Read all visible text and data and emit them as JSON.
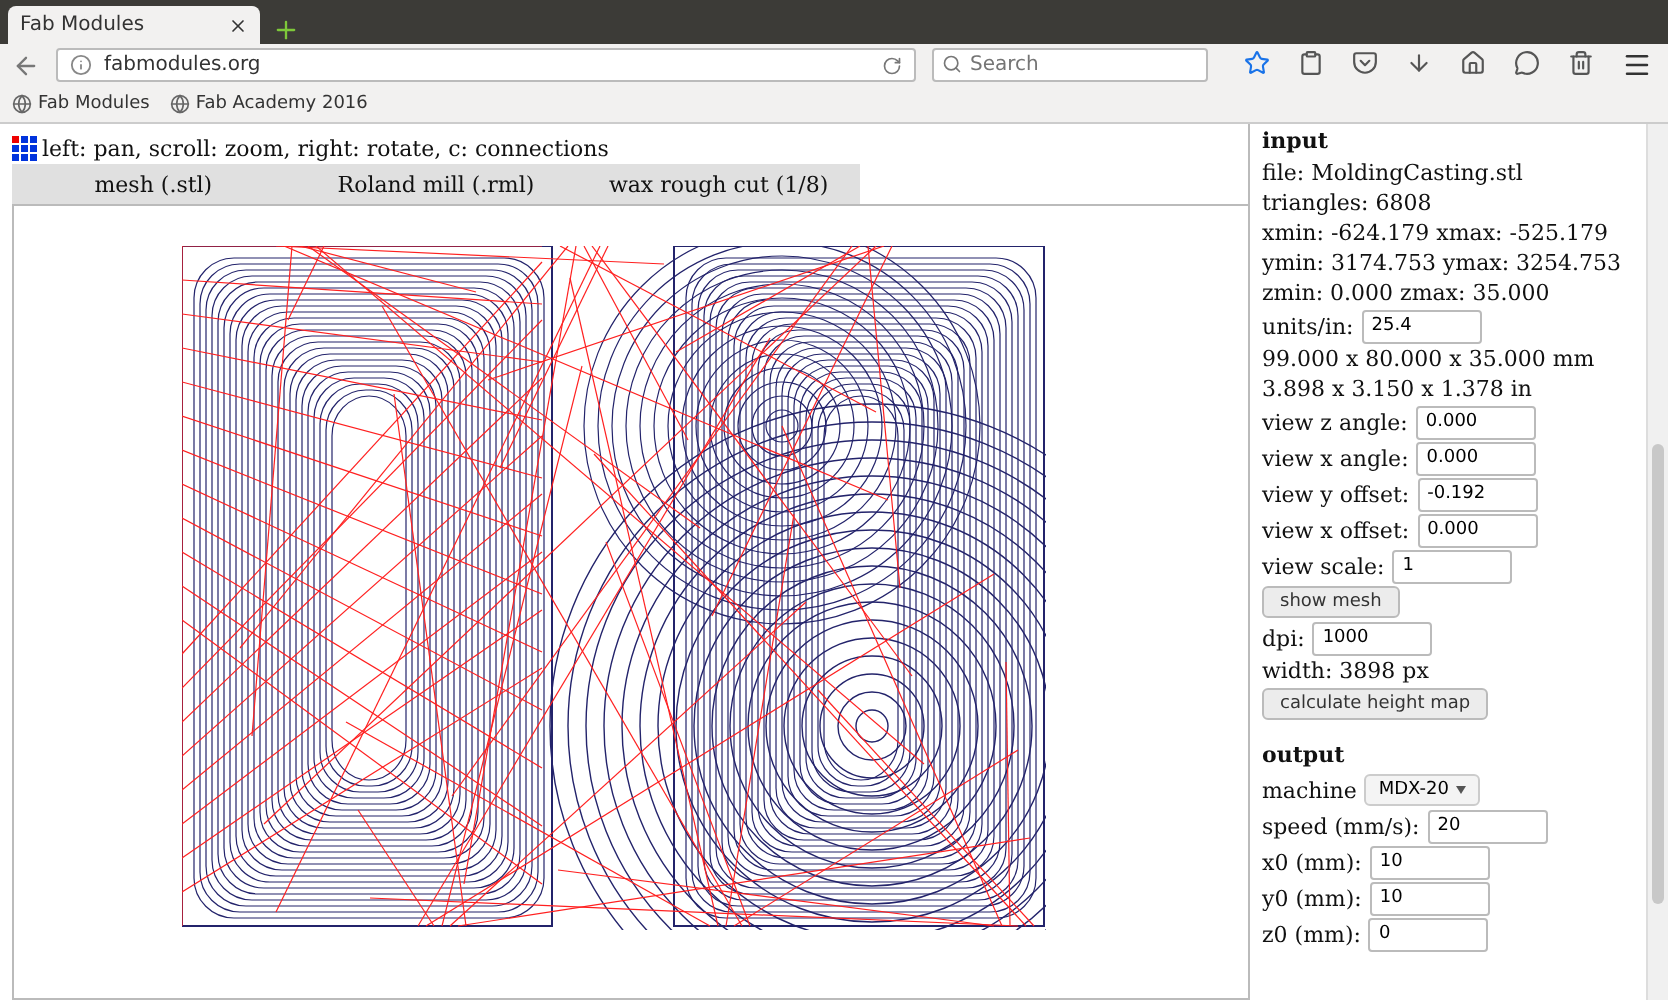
{
  "browser": {
    "tab_title": "Fab Modules",
    "url": "fabmodules.org",
    "search_placeholder": "Search",
    "bookmarks": [
      "Fab Modules",
      "Fab Academy 2016"
    ]
  },
  "page": {
    "hint": "left: pan, scroll: zoom, right: rotate, c: connections",
    "modules": [
      {
        "label": "mesh (.stl)"
      },
      {
        "label": "Roland mill (.rml)"
      },
      {
        "label": "wax rough cut (1/8)"
      }
    ],
    "panel": [
      {
        "kind": "heading",
        "text": "input"
      },
      {
        "kind": "text",
        "text": "file: MoldingCasting.stl"
      },
      {
        "kind": "text",
        "text": "triangles: 6808"
      },
      {
        "kind": "text",
        "text": "xmin: -624.179 xmax: -525.179"
      },
      {
        "kind": "text",
        "text": "ymin: 3174.753 ymax: 3254.753"
      },
      {
        "kind": "text",
        "text": "zmin: 0.000 zmax: 35.000"
      },
      {
        "kind": "field",
        "label": "units/in:",
        "value": "25.4"
      },
      {
        "kind": "text",
        "text": "99.000 x 80.000 x 35.000 mm"
      },
      {
        "kind": "text",
        "text": "3.898 x 3.150 x 1.378 in"
      },
      {
        "kind": "field",
        "label": "view z angle:",
        "value": "0.000"
      },
      {
        "kind": "field",
        "label": "view x angle:",
        "value": "0.000"
      },
      {
        "kind": "field",
        "label": "view y offset:",
        "value": "-0.192"
      },
      {
        "kind": "field",
        "label": "view x offset:",
        "value": "0.000"
      },
      {
        "kind": "field",
        "label": "view scale:",
        "value": "1"
      },
      {
        "kind": "button",
        "text": "show mesh"
      },
      {
        "kind": "field",
        "label": "dpi:",
        "value": "1000"
      },
      {
        "kind": "text",
        "text": "width: 3898 px"
      },
      {
        "kind": "button",
        "text": "calculate height map"
      },
      {
        "kind": "heading",
        "text": "output"
      },
      {
        "kind": "select",
        "label": "machine",
        "value": "MDX-20"
      },
      {
        "kind": "field",
        "label": "speed (mm/s):",
        "value": "20"
      },
      {
        "kind": "field",
        "label": "x0 (mm):",
        "value": "10"
      },
      {
        "kind": "field",
        "label": "y0 (mm):",
        "value": "10"
      },
      {
        "kind": "field",
        "label": "z0 (mm):",
        "value": "0"
      }
    ]
  }
}
